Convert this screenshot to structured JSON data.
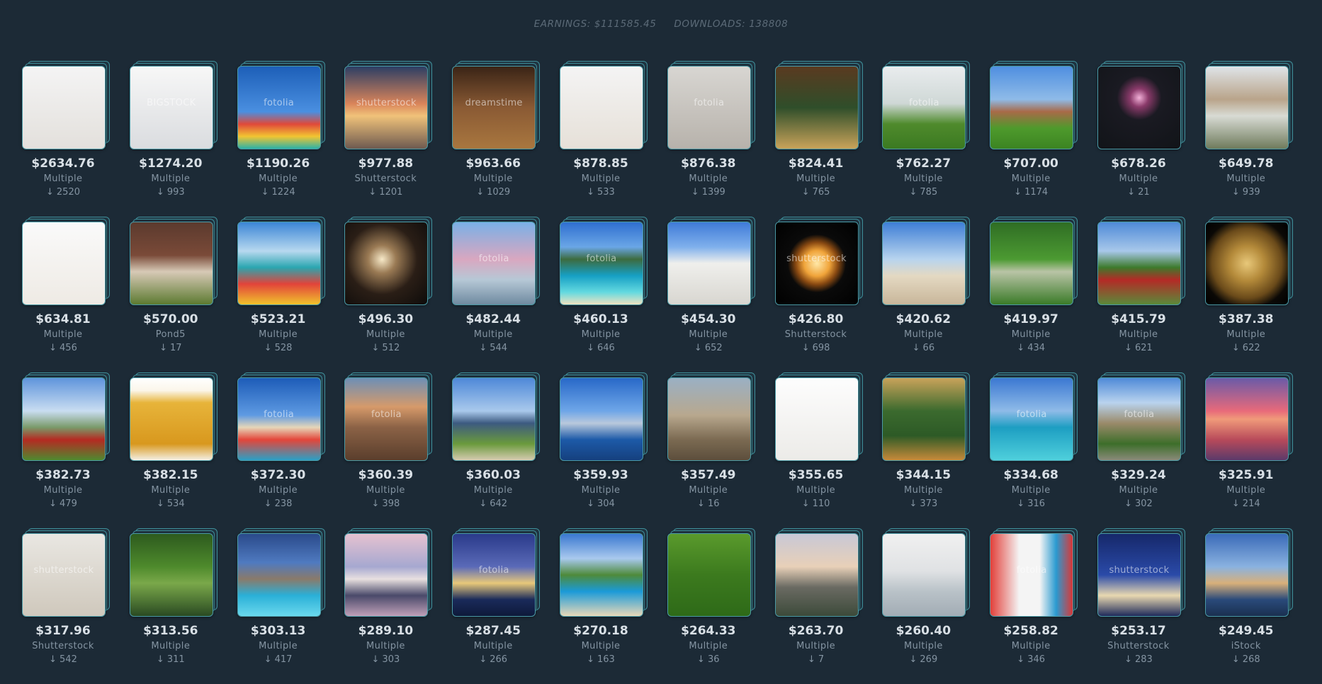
{
  "header": {
    "earnings": "EARNINGS: $111585.45",
    "downloads": "DOWNLOADS: 138808"
  },
  "download_icon": "↓",
  "items": [
    {
      "price": "$2634.76",
      "source": "Multiple",
      "downloads": "2520",
      "subject": "cat-photo",
      "watermark": "",
      "bg": "linear-gradient(#f4f4f4,#e3e0dc)"
    },
    {
      "price": "$1274.20",
      "source": "Multiple",
      "downloads": "993",
      "subject": "ice-bag-photo",
      "watermark": "BIGSTOCK",
      "bg": "linear-gradient(#f7f7f7,#dadcdf)"
    },
    {
      "price": "$1190.26",
      "source": "Multiple",
      "downloads": "1224",
      "subject": "surfboards-photo",
      "watermark": "fotolia",
      "bg": "linear-gradient(180deg,#1d5fb8 0%,#4a8fe0 55%,#e0493a 70%,#f2c531 85%,#2bb2a8 100%)"
    },
    {
      "price": "$977.88",
      "source": "Shutterstock",
      "downloads": "1201",
      "subject": "monument-sunset-photo",
      "watermark": "shutterstock",
      "bg": "linear-gradient(180deg,#2c3e64 0%,#d9845a 45%,#f0c27a 60%,#6e5a50 100%)"
    },
    {
      "price": "$963.66",
      "source": "Multiple",
      "downloads": "1029",
      "subject": "barn-photo",
      "watermark": "dreamstime",
      "bg": "linear-gradient(180deg,#3a2416 0%,#8a5a34 50%,#a9773f 100%)"
    },
    {
      "price": "$878.85",
      "source": "Multiple",
      "downloads": "533",
      "subject": "cat-photo",
      "watermark": "",
      "bg": "linear-gradient(#f4f4f4,#e6e0d8)"
    },
    {
      "price": "$876.38",
      "source": "Multiple",
      "downloads": "1399",
      "subject": "air-vent-photo",
      "watermark": "fotolia",
      "bg": "linear-gradient(#d8d6d2,#b7b2ab)"
    },
    {
      "price": "$824.41",
      "source": "Multiple",
      "downloads": "765",
      "subject": "christmas-tree-photo",
      "watermark": "",
      "bg": "linear-gradient(180deg,#5a3a20 0%,#2f4e2a 50%,#c9a35a 100%)"
    },
    {
      "price": "$762.27",
      "source": "Multiple",
      "downloads": "785",
      "subject": "golf-field-photo",
      "watermark": "fotolia",
      "bg": "linear-gradient(180deg,#e9ecee 0%,#cfd8d6 45%,#4f8a2c 70%,#3b7a21 100%)"
    },
    {
      "price": "$707.00",
      "source": "Multiple",
      "downloads": "1174",
      "subject": "house-lawn-photo",
      "watermark": "",
      "bg": "linear-gradient(180deg,#4f8fe0 0%,#8fbbe8 40%,#a86a48 55%,#4e9a2c 75%,#3c8422 100%)"
    },
    {
      "price": "$678.26",
      "source": "Multiple",
      "downloads": "21",
      "subject": "fireworks-photo",
      "watermark": "",
      "bg": "radial-gradient(circle at 50% 38%,#f2b0d8 0%,#8a3a6a 14%,#1a1a22 34%,#111418 100%)"
    },
    {
      "price": "$649.78",
      "source": "Multiple",
      "downloads": "939",
      "subject": "foreclosure-sign-photo",
      "watermark": "",
      "bg": "linear-gradient(180deg,#dfe4e8 0%,#b9a48a 40%,#d8dbd4 60%,#6f7b5c 100%)"
    },
    {
      "price": "$634.81",
      "source": "Multiple",
      "downloads": "456",
      "subject": "cat-photo",
      "watermark": "",
      "bg": "linear-gradient(#fafafa,#eeeae4)"
    },
    {
      "price": "$570.00",
      "source": "Pond5",
      "downloads": "17",
      "subject": "foreclosure-sign-photo",
      "watermark": "",
      "bg": "linear-gradient(180deg,#5b3a2e 0%,#7a4a38 40%,#d7c9b6 60%,#5c7a30 100%)"
    },
    {
      "price": "$523.21",
      "source": "Multiple",
      "downloads": "528",
      "subject": "surfboards-waves-photo",
      "watermark": "",
      "bg": "linear-gradient(180deg,#3c86d6 0%,#b7d8ef 35%,#2aa6b0 55%,#e2433a 75%,#f1c32c 100%)"
    },
    {
      "price": "$496.30",
      "source": "Multiple",
      "downloads": "512",
      "subject": "train-tunnel-photo",
      "watermark": "",
      "bg": "radial-gradient(circle at 45% 45%,#f7e9c8 0%,#9a7a54 22%,#2a1e16 55%,#0d0b0a 100%)"
    },
    {
      "price": "$482.44",
      "source": "Multiple",
      "downloads": "544",
      "subject": "cherry-blossom-monument-photo",
      "watermark": "fotolia",
      "bg": "linear-gradient(180deg,#7ab0e6 0%,#d9a7c0 45%,#b6c8d6 70%,#6f8aa0 100%)"
    },
    {
      "price": "$460.13",
      "source": "Multiple",
      "downloads": "646",
      "subject": "tropical-beach-photo",
      "watermark": "fotolia",
      "bg": "linear-gradient(180deg,#2f6fd0 0%,#6aa6e6 30%,#3d6b3f 45%,#16a0c4 65%,#63d9e0 85%,#f0e2c0 100%)"
    },
    {
      "price": "$454.30",
      "source": "Multiple",
      "downloads": "652",
      "subject": "supreme-court-photo",
      "watermark": "",
      "bg": "linear-gradient(180deg,#3f7ad8 0%,#7fb0ec 30%,#efefec 50%,#d8d6d0 100%)"
    },
    {
      "price": "$426.80",
      "source": "Shutterstock",
      "downloads": "698",
      "subject": "candle-photo",
      "watermark": "shutterstock",
      "bg": "radial-gradient(circle at 50% 50%,#ffe8a8 0%,#f0a43a 22%,#8a4a12 36%,#0a0a0a 50%,#000 100%)"
    },
    {
      "price": "$420.62",
      "source": "Multiple",
      "downloads": "66",
      "subject": "airplane-beach-photo",
      "watermark": "",
      "bg": "linear-gradient(180deg,#3e7ed6 0%,#b8d4ee 45%,#e4d9c2 65%,#c8b69a 100%)"
    },
    {
      "price": "$419.97",
      "source": "Multiple",
      "downloads": "434",
      "subject": "rope-bridge-photo",
      "watermark": "",
      "bg": "linear-gradient(180deg,#2f6d24 0%,#4c9a32 45%,#b9c4a6 60%,#3a7b28 100%)"
    },
    {
      "price": "$415.79",
      "source": "Multiple",
      "downloads": "621",
      "subject": "drill-truck-photo",
      "watermark": "",
      "bg": "linear-gradient(180deg,#4f8ad8 0%,#a8c8ea 35%,#3d7a2c 55%,#b42a26 70%,#5a8a3a 100%)"
    },
    {
      "price": "$387.38",
      "source": "Multiple",
      "downloads": "622",
      "subject": "clock-gears-photo",
      "watermark": "",
      "bg": "radial-gradient(circle at 50% 50%,#e8c87a 0%,#b48a3a 30%,#6a4a1a 60%,#0b0906 78%,#000 100%)"
    },
    {
      "price": "$382.73",
      "source": "Multiple",
      "downloads": "479",
      "subject": "drill-truck-photo",
      "watermark": "",
      "bg": "linear-gradient(180deg,#5f94dc 0%,#c9ddf1 40%,#7a9a6a 60%,#b52a22 75%,#4e8a30 100%)"
    },
    {
      "price": "$382.15",
      "source": "Multiple",
      "downloads": "534",
      "subject": "beer-glass-photo",
      "watermark": "",
      "bg": "linear-gradient(180deg,#ffffff 0%,#fbf6ea 15%,#e7b43a 30%,#d8981e 80%,#f4f0e6 100%)"
    },
    {
      "price": "$372.30",
      "source": "Multiple",
      "downloads": "238",
      "subject": "surfboards-photo",
      "watermark": "fotolia",
      "bg": "linear-gradient(180deg,#1d5cb8 0%,#5e9ae2 45%,#e6d6b8 60%,#e3463a 75%,#2aa0c6 100%)"
    },
    {
      "price": "$360.39",
      "source": "Multiple",
      "downloads": "398",
      "subject": "misty-hills-photo",
      "watermark": "fotolia",
      "bg": "linear-gradient(180deg,#6d8fb6 0%,#d69a6a 35%,#8b6246 60%,#5a3e2c 100%)"
    },
    {
      "price": "$360.03",
      "source": "Multiple",
      "downloads": "642",
      "subject": "city-park-photo",
      "watermark": "",
      "bg": "linear-gradient(180deg,#4e88d8 0%,#a9c9ec 40%,#3c5a80 55%,#6a9a3c 80%,#d6cbb0 100%)"
    },
    {
      "price": "$359.93",
      "source": "Multiple",
      "downloads": "304",
      "subject": "city-skyline-water-photo",
      "watermark": "",
      "bg": "linear-gradient(180deg,#2868c8 0%,#6ea6e8 40%,#b9c9dc 55%,#1d5aa8 75%,#15407e 100%)"
    },
    {
      "price": "$357.49",
      "source": "Multiple",
      "downloads": "16",
      "subject": "hazy-city-photo",
      "watermark": "",
      "bg": "linear-gradient(180deg,#9ab0c4 0%,#b8a88e 45%,#7b6a52 75%,#5c4e3c 100%)"
    },
    {
      "price": "$355.65",
      "source": "Multiple",
      "downloads": "110",
      "subject": "wristwatch-photo",
      "watermark": "",
      "bg": "linear-gradient(#fdfdfd,#ecebe8)"
    },
    {
      "price": "$344.15",
      "source": "Multiple",
      "downloads": "373",
      "subject": "christmas-tree-photo",
      "watermark": "",
      "bg": "linear-gradient(180deg,#c9a35a 0%,#3b6a2e 40%,#2d5a26 70%,#c78a3a 100%)"
    },
    {
      "price": "$334.68",
      "source": "Multiple",
      "downloads": "316",
      "subject": "ocean-coast-photo",
      "watermark": "fotolia",
      "bg": "linear-gradient(180deg,#3b78d2 0%,#8fbbe8 40%,#1d9ec2 60%,#4fd0dc 100%)"
    },
    {
      "price": "$329.24",
      "source": "Multiple",
      "downloads": "302",
      "subject": "village-street-photo",
      "watermark": "fotolia",
      "bg": "linear-gradient(180deg,#4f8ad8 0%,#b9d3ee 30%,#9a8a6a 55%,#3d6e2a 80%,#8a8a7a 100%)"
    },
    {
      "price": "$325.91",
      "source": "Multiple",
      "downloads": "214",
      "subject": "monument-reflection-photo",
      "watermark": "",
      "bg": "linear-gradient(180deg,#6a5aa8 0%,#e86a7a 40%,#f09a7a 50%,#b84a5a 75%,#5a3a6a 100%)"
    },
    {
      "price": "$317.96",
      "source": "Shutterstock",
      "downloads": "542",
      "subject": "ceiling-vent-photo",
      "watermark": "shutterstock",
      "bg": "linear-gradient(#e9e7e2,#cfc8bc)"
    },
    {
      "price": "$313.56",
      "source": "Multiple",
      "downloads": "311",
      "subject": "forest-stream-photo",
      "watermark": "",
      "bg": "linear-gradient(180deg,#2d5a1e 0%,#4e8a2c 40%,#7aa84a 60%,#2a4a22 100%)"
    },
    {
      "price": "$303.13",
      "source": "Multiple",
      "downloads": "417",
      "subject": "pool-resort-photo",
      "watermark": "",
      "bg": "linear-gradient(180deg,#2a4a8a 0%,#4f7ac0 35%,#8a7a6a 55%,#2ab0d8 75%,#6ad8ec 100%)"
    },
    {
      "price": "$289.10",
      "source": "Multiple",
      "downloads": "303",
      "subject": "memorial-blossoms-photo",
      "watermark": "",
      "bg": "linear-gradient(180deg,#e6c2d0 0%,#a6a8d0 40%,#e8e0e0 55%,#4a4a6a 75%,#c0a0b8 100%)"
    },
    {
      "price": "$287.45",
      "source": "Multiple",
      "downloads": "266",
      "subject": "night-skyline-photo",
      "watermark": "fotolia",
      "bg": "linear-gradient(180deg,#2a3a8a 0%,#5a6ab8 40%,#e8c87a 60%,#1a2a5a 80%,#0e1a3a 100%)"
    },
    {
      "price": "$270.18",
      "source": "Multiple",
      "downloads": "163",
      "subject": "swimming-pool-photo",
      "watermark": "",
      "bg": "linear-gradient(180deg,#3a78d0 0%,#a9c9ee 30%,#4e8a3a 50%,#1a9ad8 70%,#e8d8b8 100%)"
    },
    {
      "price": "$264.33",
      "source": "Multiple",
      "downloads": "36",
      "subject": "cat-grass-photo",
      "watermark": "",
      "bg": "linear-gradient(180deg,#5a9a2c 0%,#3c7a1e 50%,#2e6a18 100%)"
    },
    {
      "price": "$263.70",
      "source": "Multiple",
      "downloads": "7",
      "subject": "airport-terminal-photo",
      "watermark": "",
      "bg": "linear-gradient(180deg,#c8c8d6 0%,#e8d0b8 40%,#6a6a62 65%,#3c4a3a 100%)"
    },
    {
      "price": "$260.40",
      "source": "Multiple",
      "downloads": "269",
      "subject": "fishing-boat-photo",
      "watermark": "",
      "bg": "linear-gradient(180deg,#f0f0f0 0%,#e0e2e4 45%,#b9c2c8 70%,#a2acb4 100%)"
    },
    {
      "price": "$258.82",
      "source": "Multiple",
      "downloads": "346",
      "subject": "surfboards-photo",
      "watermark": "fotolia",
      "bg": "linear-gradient(90deg,#e2403a 0%,#f4f4f4 35%,#f4f4f4 60%,#2a9ad0 80%,#d83838 100%)"
    },
    {
      "price": "$253.17",
      "source": "Shutterstock",
      "downloads": "283",
      "subject": "monument-night-photo",
      "watermark": "shutterstock",
      "bg": "linear-gradient(180deg,#16286a 0%,#2a4aa8 50%,#e8d8b0 75%,#1e2a5a 100%)"
    },
    {
      "price": "$249.45",
      "source": "iStock",
      "downloads": "268",
      "subject": "harbour-bridge-photo",
      "watermark": "",
      "bg": "linear-gradient(180deg,#3a6ab8 0%,#8ab2e0 40%,#d8b07a 60%,#2a4a7a 80%,#1a3050 100%)"
    }
  ]
}
